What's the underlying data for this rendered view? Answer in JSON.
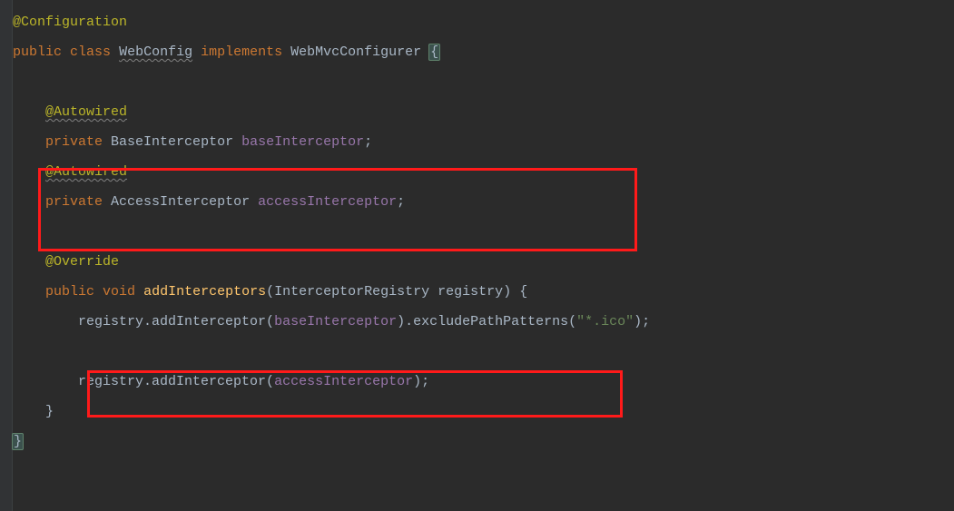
{
  "lines": {
    "l1_annotation": "@Configuration",
    "l2_public": "public",
    "l2_class": "class",
    "l2_name": "WebConfig",
    "l2_implements": "implements",
    "l2_iface": "WebMvcConfigurer",
    "l2_brace": "{",
    "l4_autowired": "@Autowired",
    "l5_private": "private",
    "l5_type": "BaseInterceptor",
    "l5_field": "baseInterceptor",
    "l5_semi": ";",
    "l6_autowired": "@Autowired",
    "l7_private": "private",
    "l7_type": "AccessInterceptor",
    "l7_field": "accessInterceptor",
    "l7_semi": ";",
    "l9_override": "@Override",
    "l10_public": "public",
    "l10_void": "void",
    "l10_method": "addInterceptors",
    "l10_paren1": "(",
    "l10_paramType": "InterceptorRegistry",
    "l10_paramName": "registry",
    "l10_paren2": ")",
    "l10_brace": " {",
    "l11_reg": "registry",
    "l11_add": ".addInterceptor(",
    "l11_field": "baseInterceptor",
    "l11_excl": ").excludePathPatterns(",
    "l11_str": "\"*.ico\"",
    "l11_end": ");",
    "l13_reg": "registry",
    "l13_add": ".addInterceptor(",
    "l13_field": "accessInterceptor",
    "l13_end": ");",
    "l14_brace": "}",
    "l15_brace": "}"
  }
}
